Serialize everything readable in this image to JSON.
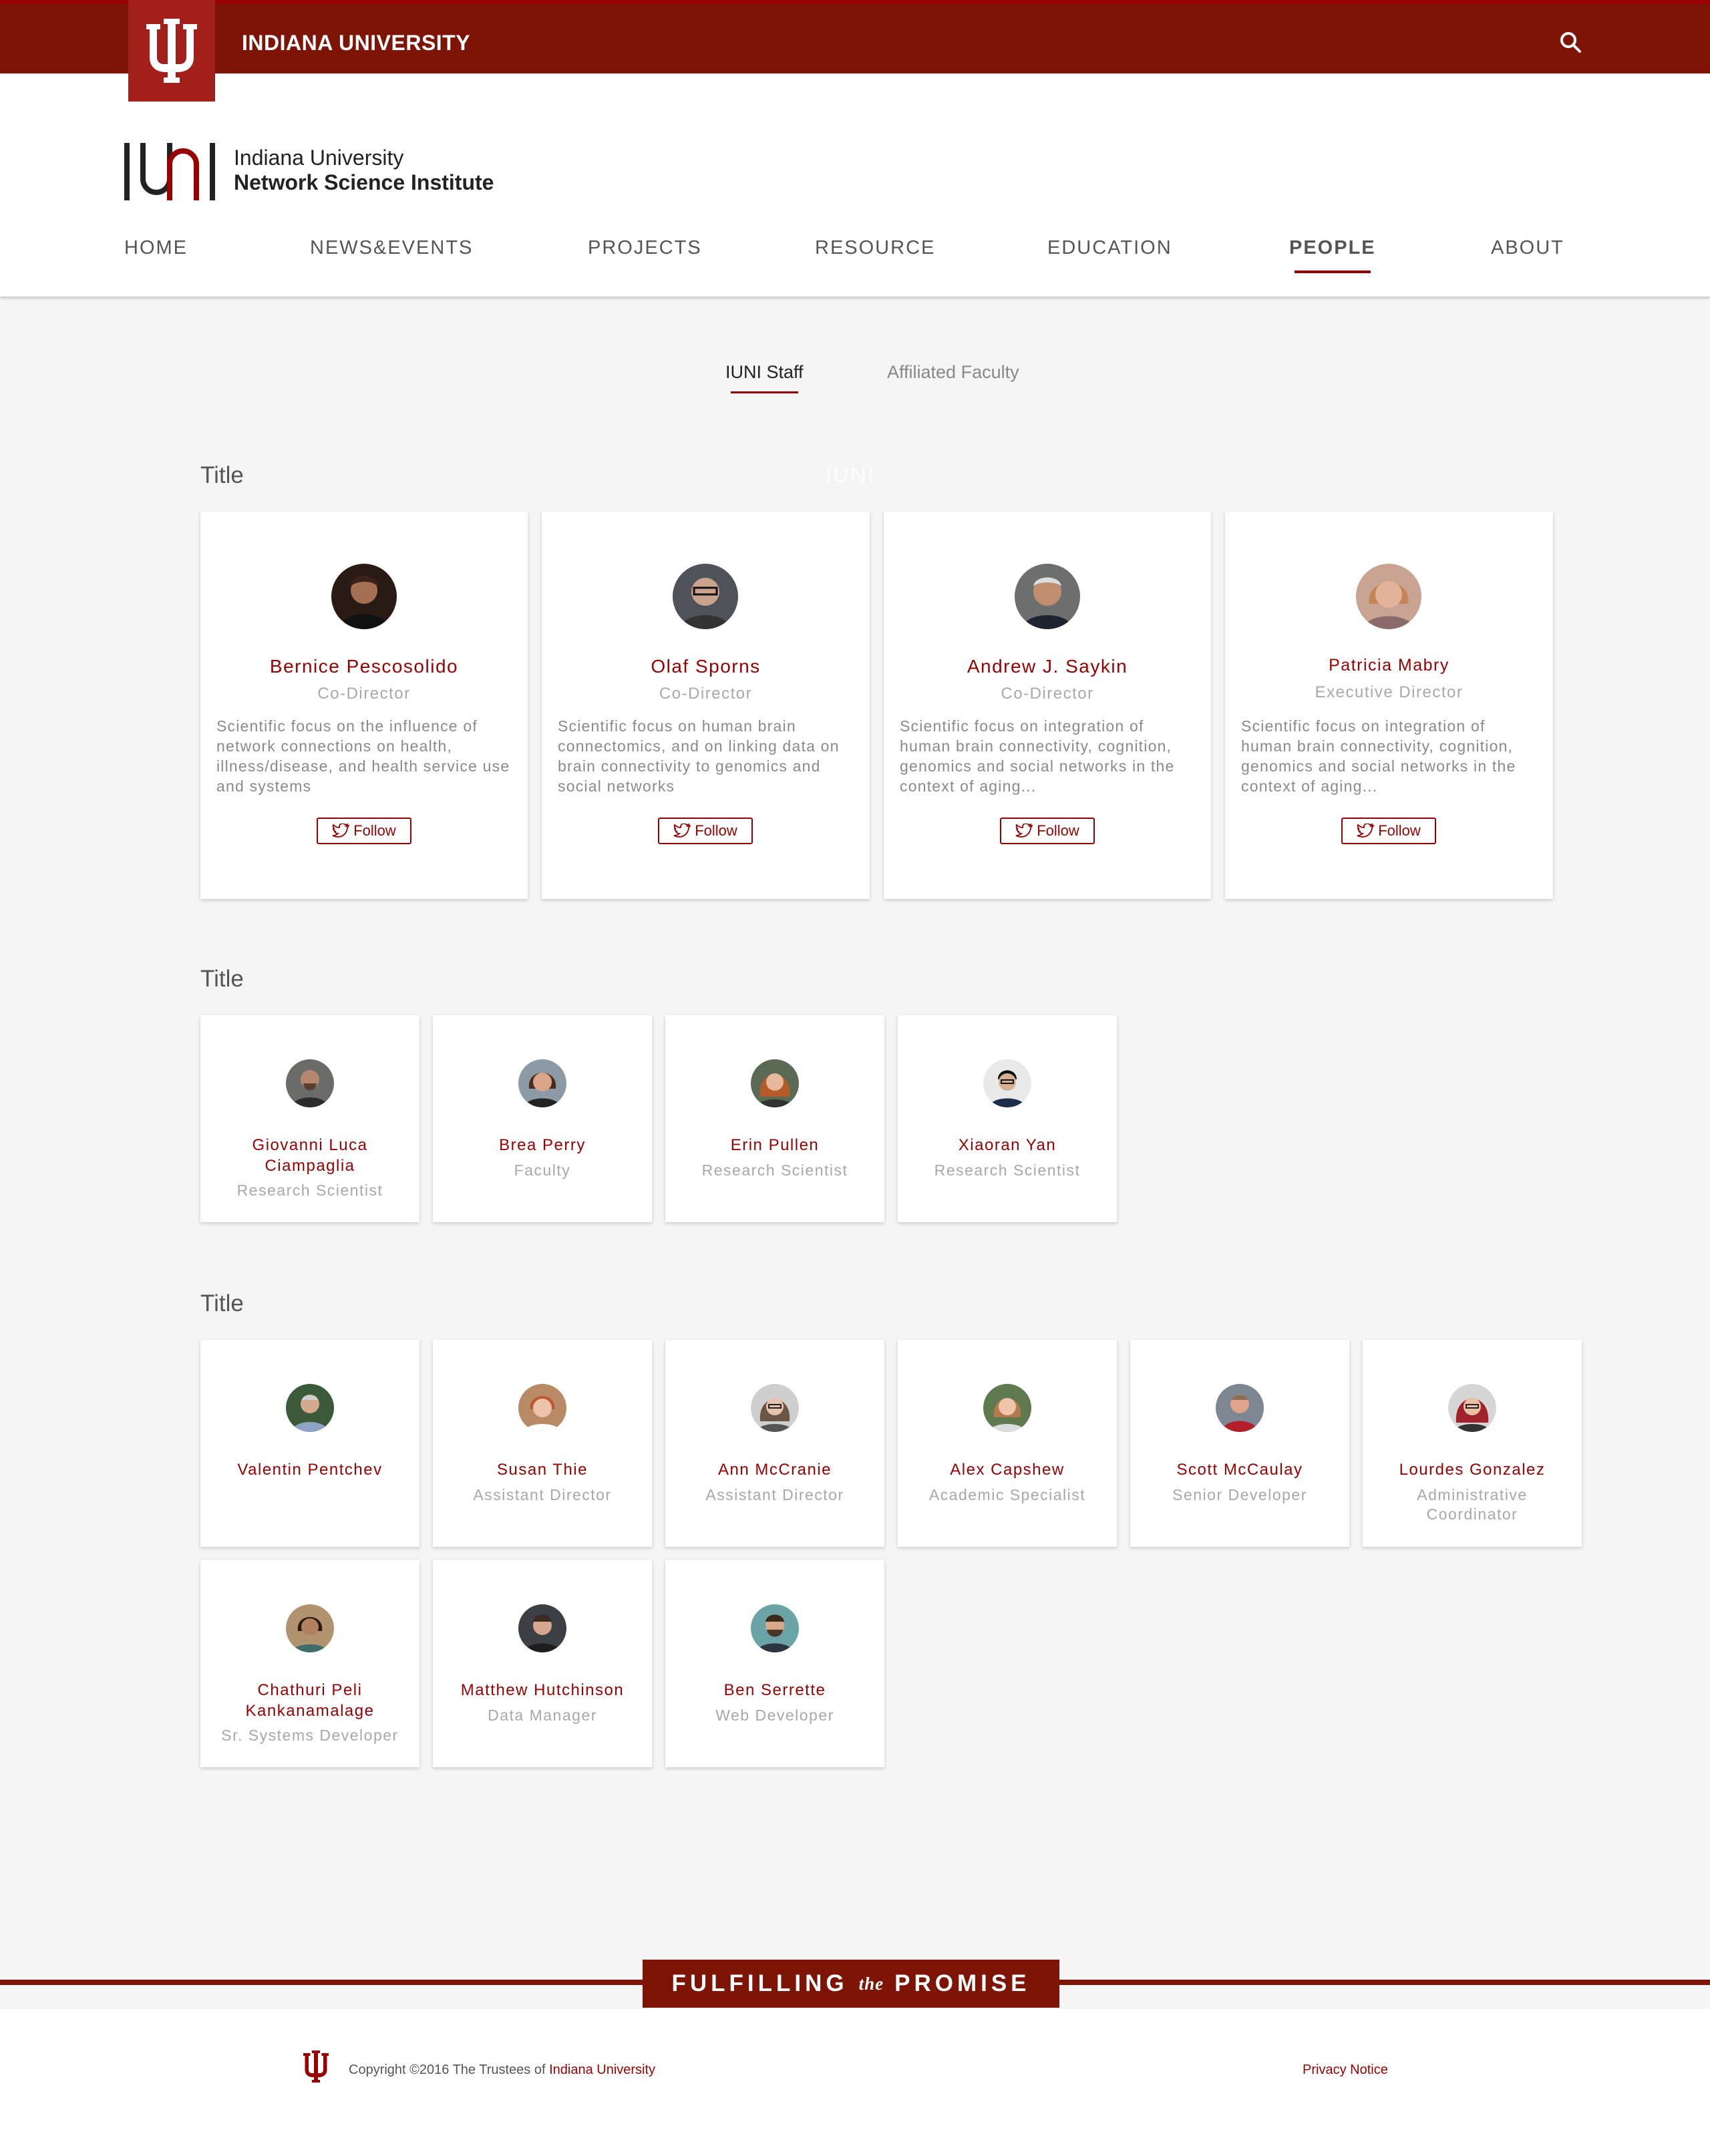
{
  "topbar": {
    "title": "INDIANA UNIVERSITY",
    "logo_icon": "iu-trident-icon",
    "search_icon": "search-icon"
  },
  "header": {
    "logo_line1": "Indiana University",
    "logo_line2": "Network Science Institute",
    "nav": [
      {
        "label": "HOME"
      },
      {
        "label": "NEWS&EVENTS"
      },
      {
        "label": "PROJECTS"
      },
      {
        "label": "RESOURCE"
      },
      {
        "label": "EDUCATION"
      },
      {
        "label": "PEOPLE",
        "active": true
      },
      {
        "label": "ABOUT"
      }
    ]
  },
  "tabs": [
    {
      "label": "IUNI Staff",
      "active": true
    },
    {
      "label": "Affiliated Faculty"
    }
  ],
  "faint_text": "IUNI",
  "sections": [
    {
      "title": "Title",
      "people": [
        {
          "name": "Bernice Pescosolido",
          "role": "Co-Director",
          "desc": "Scientific focus on the influence of network connections on health, illness/disease, and health service use and systems",
          "follow": "Follow"
        },
        {
          "name": "Olaf Sporns",
          "role": "Co-Director",
          "desc": "Scientific focus on human brain connectomics, and on linking data on brain connectivity to genomics and social networks",
          "follow": "Follow"
        },
        {
          "name": "Andrew J. Saykin",
          "role": "Co-Director",
          "desc": "Scientific focus on integration of human brain connectivity, cognition, genomics and social networks in the context of aging...",
          "follow": "Follow"
        },
        {
          "name": "Patricia Mabry",
          "role": "Executive Director",
          "desc": "Scientific focus on integration of human brain connectivity, cognition, genomics and social networks in the context of aging...",
          "follow": "Follow"
        }
      ]
    },
    {
      "title": "Title",
      "people": [
        {
          "name": "Giovanni Luca Ciampaglia",
          "role": "Research Scientist"
        },
        {
          "name": "Brea Perry",
          "role": "Faculty"
        },
        {
          "name": "Erin Pullen",
          "role": "Research Scientist"
        },
        {
          "name": "Xiaoran Yan",
          "role": "Research Scientist"
        }
      ]
    },
    {
      "title": "Title",
      "people": [
        {
          "name": "Valentin Pentchev",
          "role": ""
        },
        {
          "name": "Susan Thie",
          "role": "Assistant Director"
        },
        {
          "name": "Ann McCranie",
          "role": "Assistant Director"
        },
        {
          "name": "Alex Capshew",
          "role": "Academic Specialist"
        },
        {
          "name": "Scott McCaulay",
          "role": "Senior Developer"
        },
        {
          "name": "Lourdes Gonzalez",
          "role": "Administrative Coordinator"
        },
        {
          "name": "Chathuri Peli Kankanamalage",
          "role": "Sr. Systems Developer"
        },
        {
          "name": "Matthew Hutchinson",
          "role": "Data Manager"
        },
        {
          "name": "Ben Serrette",
          "role": "Web Developer"
        }
      ]
    }
  ],
  "footer": {
    "banner_left": "FULFILLING",
    "banner_the": "the",
    "banner_right": "PROMISE",
    "copy_prefix": "Copyright ©2016 The Trustees of",
    "copy_link": "Indiana University",
    "privacy": "Privacy Notice"
  },
  "colors": {
    "crimson": "#990000",
    "bar": "#7d1406",
    "logo_box": "#a31f1a"
  }
}
